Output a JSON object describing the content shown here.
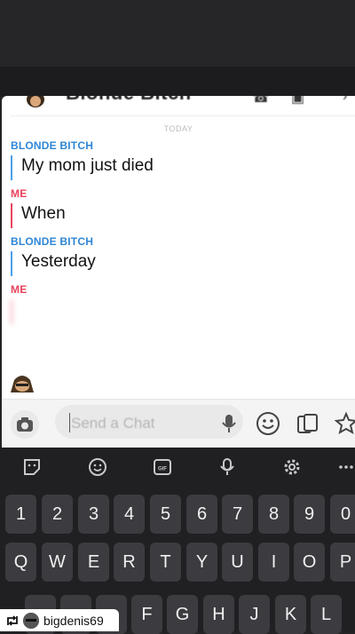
{
  "header": {
    "contact_name": "Blonde Bitch",
    "icons": [
      "phone-icon",
      "video-icon",
      "close-icon"
    ]
  },
  "chat": {
    "day_label": "TODAY",
    "messages": [
      {
        "sender": "BLONDE BITCH",
        "text": "My mom just died"
      },
      {
        "sender": "ME",
        "text": "When"
      },
      {
        "sender": "BLONDE BITCH",
        "text": "Yesterday"
      },
      {
        "sender": "ME",
        "text": ""
      }
    ]
  },
  "input_bar": {
    "placeholder": "Send a Chat",
    "icons": [
      "camera-icon",
      "microphone-icon",
      "sticker-icon",
      "cards-icon",
      "game-icon"
    ]
  },
  "keyboard": {
    "toolbar_icons": [
      "sticker-icon",
      "emoji-icon",
      "gif-icon",
      "microphone-icon",
      "settings-icon",
      "more-icon"
    ],
    "gif_label": "GIF",
    "number_row": [
      "1",
      "2",
      "3",
      "4",
      "5",
      "6",
      "7",
      "8",
      "9",
      "0"
    ],
    "top_row": [
      "Q",
      "W",
      "E",
      "R",
      "T",
      "Y",
      "U",
      "I",
      "O",
      "P"
    ],
    "middle_row": [
      "F",
      "G",
      "H",
      "J",
      "K",
      "L"
    ]
  },
  "watermark": {
    "username": "bigdenis69"
  },
  "colors": {
    "friend": "#2f86d6",
    "me": "#e8445c",
    "keyboard_bg": "#202023",
    "key_bg": "#3b3b40"
  }
}
